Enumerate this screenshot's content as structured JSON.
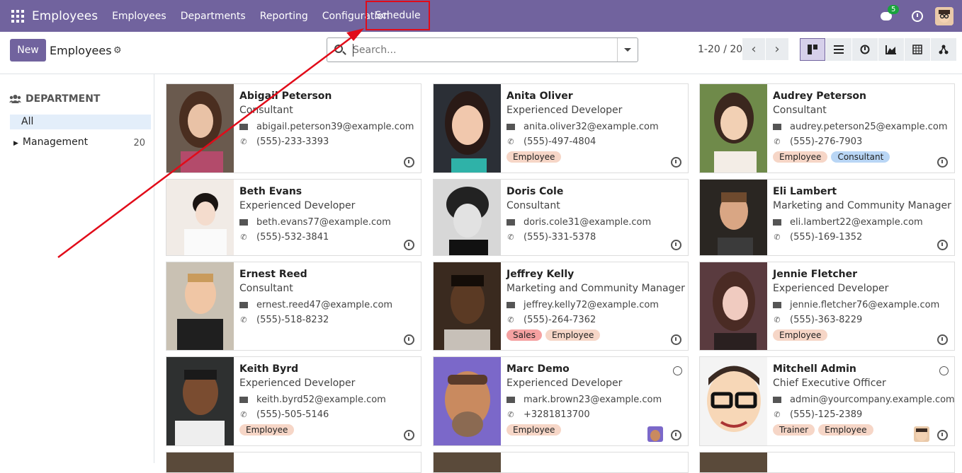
{
  "topbar": {
    "brand": "Employees",
    "menu": [
      "Employees",
      "Departments",
      "Reporting",
      "Configuration"
    ],
    "schedule": "Schedule",
    "chat_count": "5"
  },
  "control": {
    "new_label": "New",
    "breadcrumb": "Employees",
    "search_placeholder": "Search...",
    "pager": "1-20 / 20"
  },
  "sidebar": {
    "title": "DEPARTMENT",
    "all": "All",
    "items": [
      {
        "label": "Management",
        "count": "20"
      }
    ]
  },
  "employees": [
    {
      "name": "Abigail Peterson",
      "job": "Consultant",
      "email": "abigail.peterson39@example.com",
      "phone": "(555)-233-3393",
      "tags": []
    },
    {
      "name": "Anita Oliver",
      "job": "Experienced Developer",
      "email": "anita.oliver32@example.com",
      "phone": "(555)-497-4804",
      "tags": [
        "Employee"
      ]
    },
    {
      "name": "Audrey Peterson",
      "job": "Consultant",
      "email": "audrey.peterson25@example.com",
      "phone": "(555)-276-7903",
      "tags": [
        "Employee",
        "Consultant"
      ]
    },
    {
      "name": "Beth Evans",
      "job": "Experienced Developer",
      "email": "beth.evans77@example.com",
      "phone": "(555)-532-3841",
      "tags": []
    },
    {
      "name": "Doris Cole",
      "job": "Consultant",
      "email": "doris.cole31@example.com",
      "phone": "(555)-331-5378",
      "tags": []
    },
    {
      "name": "Eli Lambert",
      "job": "Marketing and Community Manager",
      "email": "eli.lambert22@example.com",
      "phone": "(555)-169-1352",
      "tags": []
    },
    {
      "name": "Ernest Reed",
      "job": "Consultant",
      "email": "ernest.reed47@example.com",
      "phone": "(555)-518-8232",
      "tags": []
    },
    {
      "name": "Jeffrey Kelly",
      "job": "Marketing and Community Manager",
      "email": "jeffrey.kelly72@example.com",
      "phone": "(555)-264-7362",
      "tags": [
        "Sales",
        "Employee"
      ]
    },
    {
      "name": "Jennie Fletcher",
      "job": "Experienced Developer",
      "email": "jennie.fletcher76@example.com",
      "phone": "(555)-363-8229",
      "tags": [
        "Employee"
      ]
    },
    {
      "name": "Keith Byrd",
      "job": "Experienced Developer",
      "email": "keith.byrd52@example.com",
      "phone": "(555)-505-5146",
      "tags": [
        "Employee"
      ]
    },
    {
      "name": "Marc Demo",
      "job": "Experienced Developer",
      "email": "mark.brown23@example.com",
      "phone": "+3281813700",
      "tags": [
        "Employee"
      ]
    },
    {
      "name": "Mitchell Admin",
      "job": "Chief Executive Officer",
      "email": "admin@yourcompany.example.com",
      "phone": "(555)-125-2389",
      "tags": [
        "Trainer",
        "Employee"
      ]
    }
  ],
  "colors": {
    "brand": "#71639e",
    "highlight": "#e10b19"
  }
}
